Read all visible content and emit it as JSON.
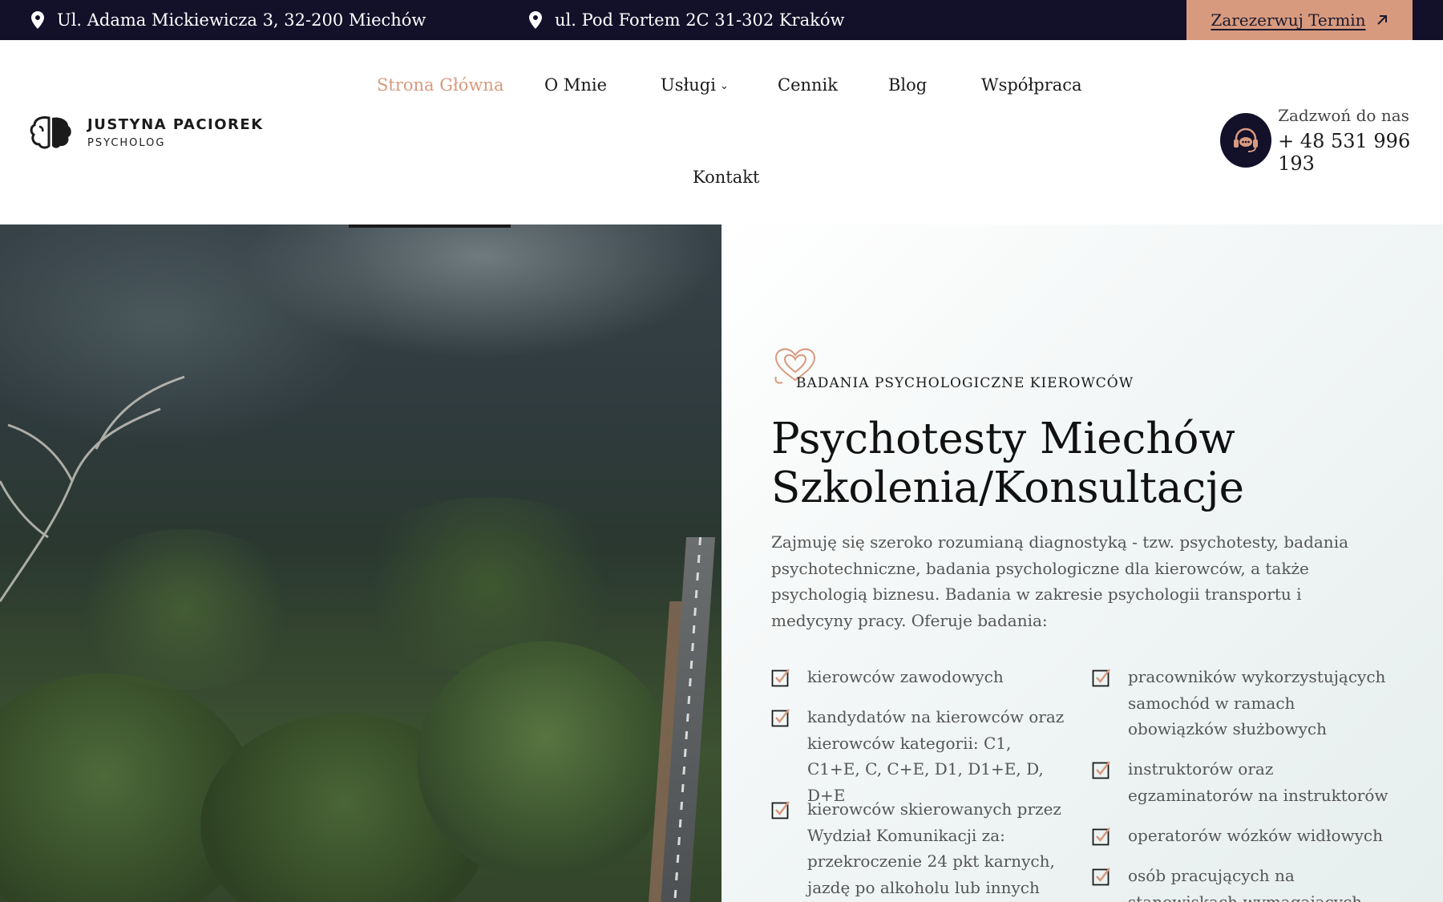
{
  "topbar": {
    "address_1": "Ul. Adama Mickiewicza 3, 32-200 Miechów",
    "address_2": "ul. Pod Fortem 2C 31-302 Kraków",
    "cta_label": "Zarezerwuj Termin",
    "cta_icon": "arrow-up-right-icon",
    "location_icon": "map-pin-icon"
  },
  "logo": {
    "name": "JUSTYNA PACIOREK",
    "subtitle": "PSYCHOLOG",
    "icon": "brain-icon"
  },
  "nav": {
    "items": [
      {
        "label": "Strona Główna",
        "active": true
      },
      {
        "label": "O Mnie",
        "active": false
      },
      {
        "label": "Usługi",
        "active": false,
        "has_dropdown": true
      },
      {
        "label": "Cennik",
        "active": false
      },
      {
        "label": "Blog",
        "active": false
      },
      {
        "label": "Współpraca",
        "active": false
      },
      {
        "label": "Kontakt",
        "active": false
      }
    ],
    "active_color": "#d89a7e"
  },
  "phone": {
    "label": "Zadzwoń do nas",
    "number": "+ 48 531 996 193",
    "icon": "support-headset-icon"
  },
  "hero": {
    "kicker": "BADANIA PSYCHOLOGICZNE KIEROWCÓW",
    "kicker_icon": "heart-outline-icon",
    "title_line_1": "Psychotesty Miechów",
    "title_line_2": "Szkolenia/Konsultacje",
    "description": "Zajmuję się szeroko rozumianą diagnostyką - tzw. psychotesty, badania psychotechniczne, badania psychologiczne dla kierowców, a także psychologią biznesu. Badania w zakresie psychologii transportu i medycyny pracy. Oferuje badania:",
    "list_left": [
      "kierowców zawodowych",
      "kandydatów na kierowców oraz kierowców kategorii: C1, C1+E, C, C+E, D1, D1+E, D, D+E",
      "kierowców skierowanych przez Wydział Komunikacji za: przekroczenie 24 pkt karnych, jazdę po alkoholu lub innych środków"
    ],
    "list_right": [
      "pracowników wykorzystujących samochód w ramach obowiązków służbowych",
      "instruktorów oraz egzaminatorów na instruktorów",
      "operatorów wózków widłowych",
      "osób pracujących na stanowiskach wymagających szczególnej"
    ],
    "check_icon": "checkbox-checked-icon"
  },
  "colors": {
    "dark": "#13102a",
    "accent": "#d89a7e"
  }
}
